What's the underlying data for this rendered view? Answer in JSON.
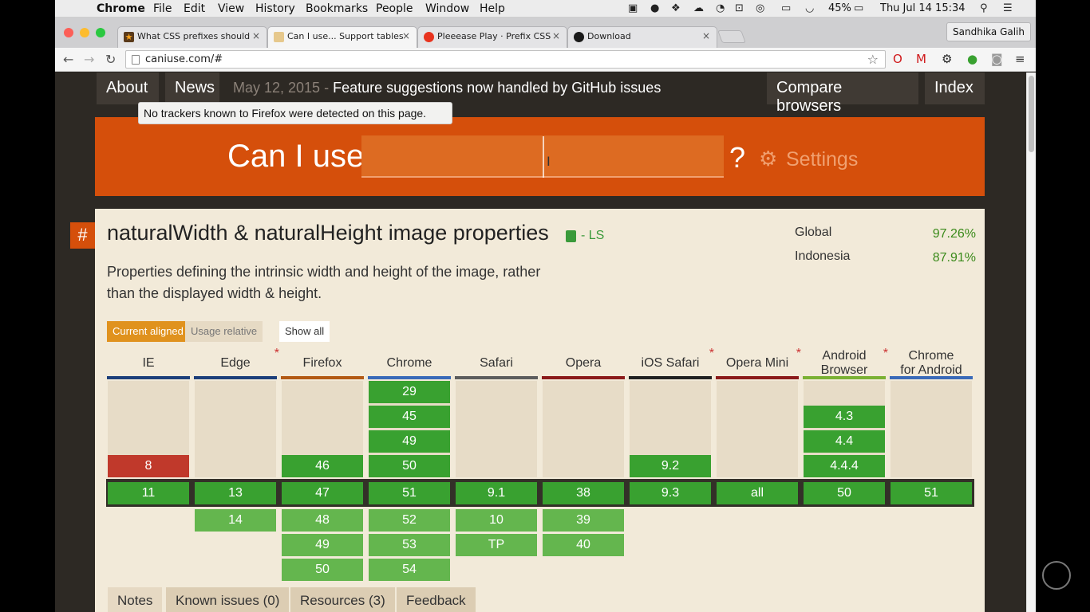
{
  "menubar": {
    "apple": "",
    "items": [
      "Chrome",
      "File",
      "Edit",
      "View",
      "History",
      "Bookmarks",
      "People",
      "Window",
      "Help"
    ],
    "battery": "45%",
    "clock": "Thu Jul 14  15:34"
  },
  "tabs": [
    {
      "title": "What CSS prefixes should",
      "close": "×"
    },
    {
      "title": "Can I use... Support tables",
      "close": "×"
    },
    {
      "title": "Pleeease Play · Prefix CSS",
      "close": "×"
    },
    {
      "title": "Download",
      "close": "×"
    }
  ],
  "profile": "Sandhika Galih",
  "url": "caniuse.com/#",
  "site": {
    "nav_about": "About",
    "nav_news": "News",
    "news_date": "May 12, 2015",
    "news_sep": " - ",
    "news_text": "Feature suggestions now handled by GitHub issues",
    "nav_compare": "Compare browsers",
    "nav_index": "Index",
    "tooltip": "No trackers known to Firefox were detected on this page.",
    "canuse": "Can I use",
    "search_value": "",
    "q": "?",
    "settings": "Settings"
  },
  "feature": {
    "hash": "#",
    "title": "naturalWidth & naturalHeight image properties",
    "status": "- LS",
    "description": "Properties defining the intrinsic width and height of the image, rather than the displayed width & height.",
    "global_label": "Global",
    "global_value": "97.26%",
    "region_label": "Indonesia",
    "region_value": "87.91%",
    "toggle_current": "Current aligned",
    "toggle_usage": "Usage relative",
    "toggle_showall": "Show all"
  },
  "browsers": [
    {
      "name": "IE",
      "star": "",
      "line": "#1d3f7a",
      "past": [
        {
          "v": "8",
          "s": "n"
        }
      ],
      "current": "11",
      "future": []
    },
    {
      "name": "Edge",
      "star": "*",
      "line": "#1d3f7a",
      "past": [],
      "current": "13",
      "future": [
        "14"
      ]
    },
    {
      "name": "Firefox",
      "star": "",
      "line": "#b35a14",
      "past": [
        {
          "v": "46",
          "s": "y"
        }
      ],
      "current": "47",
      "future": [
        "48",
        "49",
        "50"
      ]
    },
    {
      "name": "Chrome",
      "star": "",
      "line": "#3a6ab8",
      "past": [
        {
          "v": "29",
          "s": "y"
        },
        {
          "v": "45",
          "s": "y"
        },
        {
          "v": "49",
          "s": "y"
        },
        {
          "v": "50",
          "s": "y"
        }
      ],
      "current": "51",
      "future": [
        "52",
        "53",
        "54"
      ]
    },
    {
      "name": "Safari",
      "star": "",
      "line": "#5d5d5d",
      "past": [],
      "current": "9.1",
      "future": [
        "10",
        "TP"
      ]
    },
    {
      "name": "Opera",
      "star": "",
      "line": "#8b1a1a",
      "past": [],
      "current": "38",
      "future": [
        "39",
        "40"
      ]
    },
    {
      "name": "iOS Safari",
      "star": "*",
      "line": "#222222",
      "past": [
        {
          "v": "9.2",
          "s": "y"
        }
      ],
      "current": "9.3",
      "future": []
    },
    {
      "name": "Opera Mini",
      "star": "*",
      "line": "#8b1a1a",
      "past": [],
      "current": "all",
      "future": []
    },
    {
      "name": "Android Browser",
      "star": "*",
      "line": "#7bb134",
      "past": [
        {
          "v": "4.3",
          "s": "y"
        },
        {
          "v": "4.4",
          "s": "y"
        },
        {
          "v": "4.4.4",
          "s": "y"
        }
      ],
      "current": "50",
      "future": []
    },
    {
      "name": "Chrome for Android",
      "star": "",
      "line": "#3a6ab8",
      "past": [],
      "current": "51",
      "future": []
    }
  ],
  "bottom_tabs": [
    "Notes",
    "Known issues (0)",
    "Resources (3)",
    "Feedback"
  ],
  "colors": {
    "supported": "#39a130",
    "supported_future": "#64b64e",
    "unsupported": "#c0392b",
    "accent": "#d54f0b"
  }
}
